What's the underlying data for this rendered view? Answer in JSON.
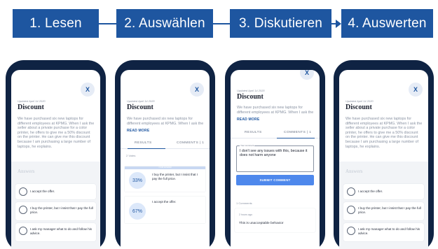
{
  "steps": [
    {
      "label": "1. Lesen"
    },
    {
      "label": "2. Auswählen"
    },
    {
      "label": "3. Diskutieren"
    },
    {
      "label": "4. Auswerten"
    }
  ],
  "colors": {
    "accent": "#1e56a0",
    "phone": "#0f2343",
    "button": "#4e88ec"
  },
  "card": {
    "close": "X",
    "updated": "Updated April 14 2020",
    "title": "Discount",
    "body": "We have purchased six new laptops for different employees at KPMG. When I ask the seller about a private purchase for a color printer, he offers to give me a 50% discount on the printer. He can give me this discount because I am purchasing a large number of laptops, he explains.",
    "body_short": "We have purchased six new laptops for different employees at KPMG. When I ask the",
    "read_more": "READ MORE",
    "answers_title": "Answers",
    "answers": [
      "I accept the offer.",
      "I buy the printer, but I insist that I pay the full price.",
      "I ask my manager what to do and follow his advice."
    ]
  },
  "tabs": {
    "results": "RESULTS",
    "comments": "COMMENTS | 1"
  },
  "results": {
    "votes": "2 Votes",
    "chip": "YOUR ANSWER",
    "items": [
      {
        "percent": "33%",
        "text": "I buy the printer, but I insist that I pay the full price.",
        "fraction": 0.33
      },
      {
        "percent": "67%",
        "text": "I accept the offer.",
        "fraction": 0.67
      }
    ]
  },
  "discuss": {
    "legend": "Your comment",
    "comment_text": "I don't see any issues with this, because it does not harm anyone",
    "submit": "SUBMIT COMMENT",
    "count": "1 Comments",
    "time": "2 hours ago",
    "posted": "This is unacceptable behavior"
  }
}
